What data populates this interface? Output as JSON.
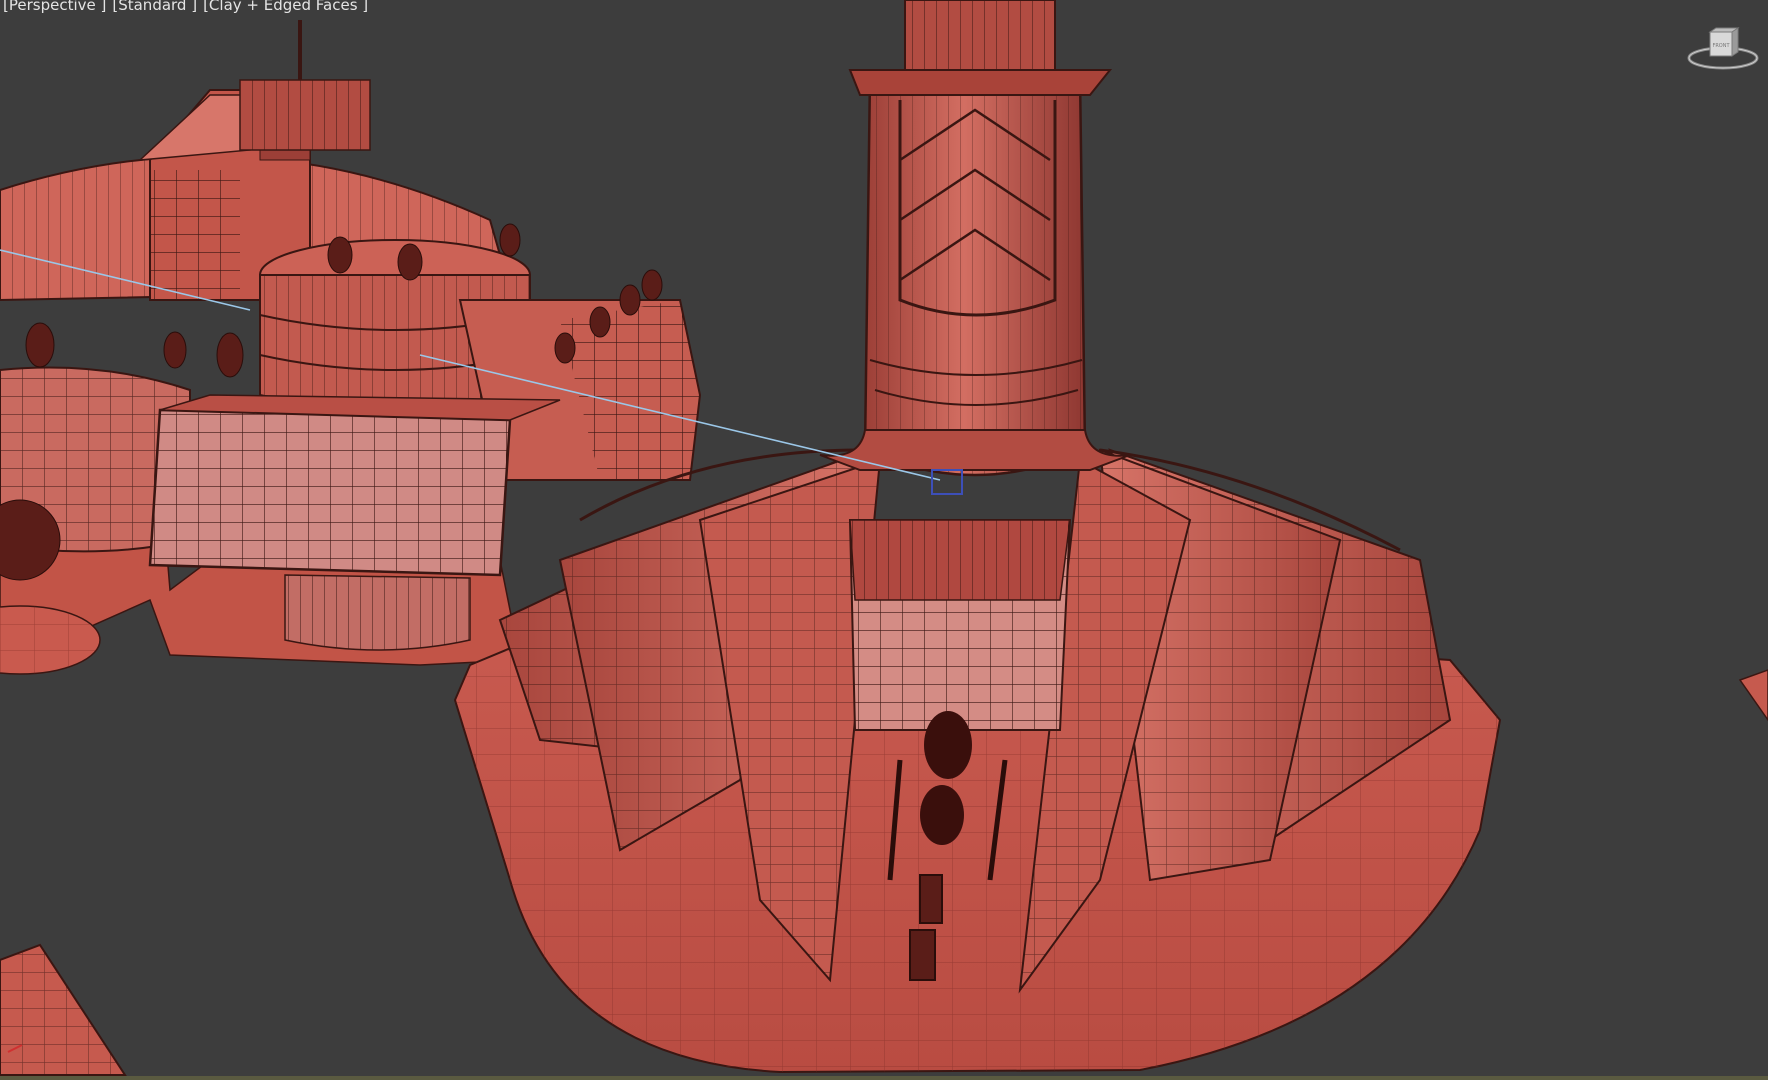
{
  "viewport": {
    "labels": [
      "[Perspective ]",
      "[Standard ]",
      "[Clay + Edged Faces ]"
    ]
  },
  "viewcube": {
    "face_label": "FRONT"
  },
  "colors": {
    "background": "#3d3d3d",
    "clay": "#c8584d",
    "clay_light": "#d9766b",
    "clay_dark": "#9c3f37",
    "edge": "#3a1612",
    "link_line": "#9bc7e8",
    "selection_box": "#3d4fb8"
  },
  "icons": {
    "viewcube": "viewcube-icon",
    "axis_tripod": "axis-tripod-icon"
  }
}
